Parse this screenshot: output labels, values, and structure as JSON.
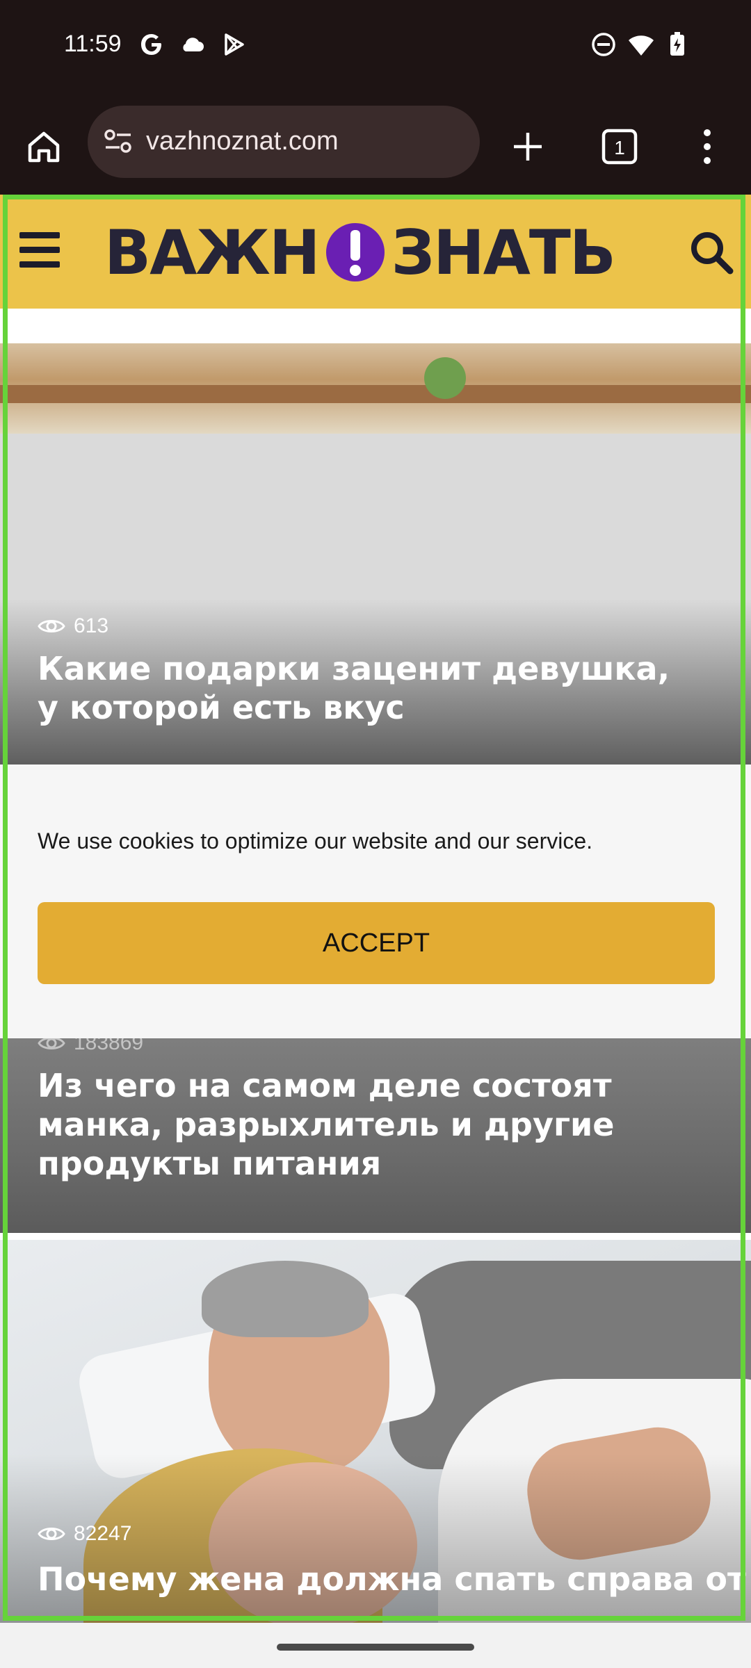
{
  "status_bar": {
    "time": "11:59",
    "icons_left": [
      "google-icon",
      "cloud-icon",
      "play-store-icon"
    ],
    "icons_right": [
      "do-not-disturb-icon",
      "wifi-icon",
      "battery-charging-icon"
    ]
  },
  "browser": {
    "url": "vazhnoznat.com",
    "tab_count": "1"
  },
  "site": {
    "logo_left": "ВАЖН",
    "logo_right": "ЗНАТЬ",
    "logo_mark": "!"
  },
  "articles": [
    {
      "views": "613",
      "title": "Какие подарки заценит девушка, у которой есть вкус"
    },
    {
      "views": "183869",
      "title": "Из чего на самом деле состоят манка, разрыхлитель и другие продукты питания"
    },
    {
      "views": "82247",
      "title": "Почему жена должна спать справа от"
    }
  ],
  "cookie": {
    "text": "We use cookies to optimize our website and our service.",
    "accept_label": "ACCEPT"
  },
  "colors": {
    "header_yellow": "#ecc34a",
    "accept_button": "#e3ac33",
    "logo_purple": "#6a1fb3",
    "frame_green": "#66d33a",
    "browser_dark": "#1e1414"
  }
}
